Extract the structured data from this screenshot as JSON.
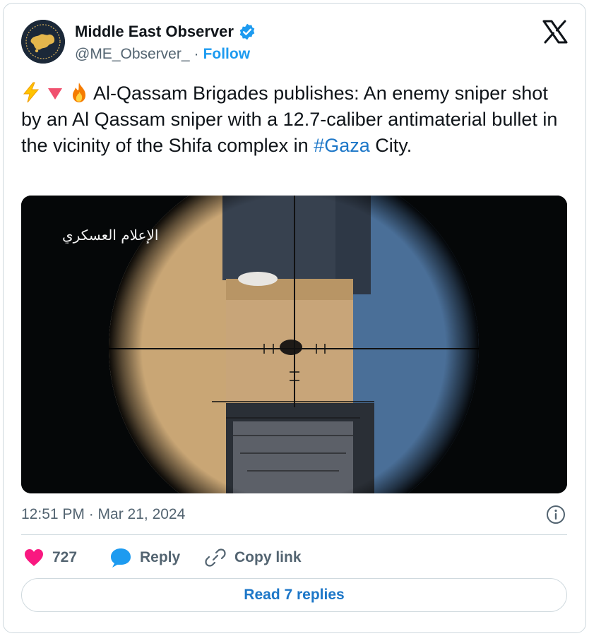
{
  "author": {
    "display_name": "Middle East Observer",
    "handle": "@ME_Observer_",
    "separator": "·",
    "follow_label": "Follow",
    "avatar_icon": "middle-east-map-emblem-icon",
    "avatar_ring_text": "MIDDLE EAST OBSERVER",
    "verified_icon": "verified-badge-icon"
  },
  "brand_icon": "x-logo-icon",
  "tweet": {
    "emojis": [
      "lightning-icon",
      "down-triangle-icon",
      "fire-icon"
    ],
    "text_main": "Al-Qassam Brigades publishes: An enemy sniper shot by an Al Qassam sniper with a 12.7-caliber antimaterial bullet in the vicinity of the Shifa complex in ",
    "hashtag": "#Gaza",
    "text_tail": " City."
  },
  "media": {
    "watermark": "الإعلام العسكري",
    "description_icon": "video-frame"
  },
  "timestamp": "12:51 PM · Mar 21, 2024",
  "info_icon": "info-icon",
  "actions": {
    "like_count": "727",
    "reply_label": "Reply",
    "copy_label": "Copy link"
  },
  "read_replies_label": "Read 7 replies",
  "colors": {
    "accent": "#1d9bf0",
    "link": "#1d77c8",
    "like": "#f91880",
    "muted": "#536471",
    "border": "#cfd9de"
  }
}
